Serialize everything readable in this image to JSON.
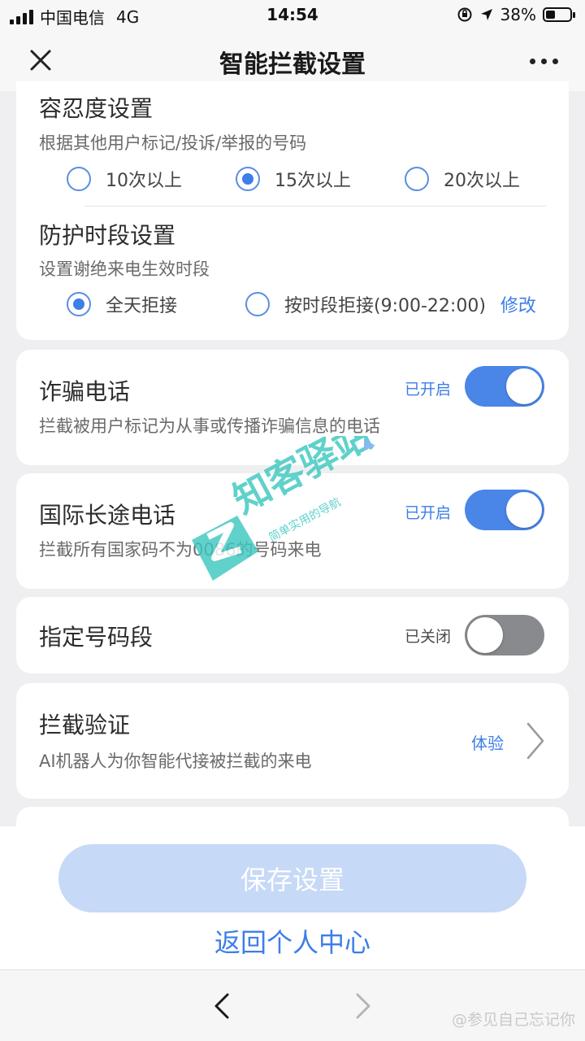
{
  "status_bar": {
    "carrier": "中国电信",
    "network": "4G",
    "time": "14:54",
    "battery": "38%",
    "battery_level": 0.38
  },
  "nav": {
    "title": "智能拦截设置"
  },
  "tolerance": {
    "title": "容忍度设置",
    "description": "根据其他用户标记/投诉/举报的号码",
    "options": [
      "10次以上",
      "15次以上",
      "20次以上"
    ],
    "selected_index": 1
  },
  "protection_period": {
    "title": "防护时段设置",
    "description": "设置谢绝来电生效时段",
    "options": [
      "全天拒接",
      "按时段拒接(9:00-22:00)"
    ],
    "selected_index": 0,
    "modify_label": "修改"
  },
  "fraud_calls": {
    "title": "诈骗电话",
    "description": "拦截被用户标记为从事或传播诈骗信息的电话",
    "status": "已开启",
    "enabled": true
  },
  "international_calls": {
    "title": "国际长途电话",
    "description": "拦截所有国家码不为0086的号码来电",
    "status": "已开启",
    "enabled": true
  },
  "number_range": {
    "title": "指定号码段",
    "status": "已关闭",
    "enabled": false
  },
  "verification": {
    "title": "拦截验证",
    "description": "AI机器人为你智能代接被拦截的来电",
    "link_label": "体验"
  },
  "footer": {
    "save_label": "保存设置",
    "back_label": "返回个人中心"
  },
  "watermark": {
    "brand": "知客驿站",
    "tagline": "简单实用的导航"
  },
  "credit": "@参见自己忘记你",
  "colors": {
    "accent": "#3d7ee8",
    "toggle_on": "#4a86e8",
    "toggle_off": "#888a8e",
    "save_disabled": "#c6d9f6",
    "watermark_teal": "#3ec8c0"
  }
}
